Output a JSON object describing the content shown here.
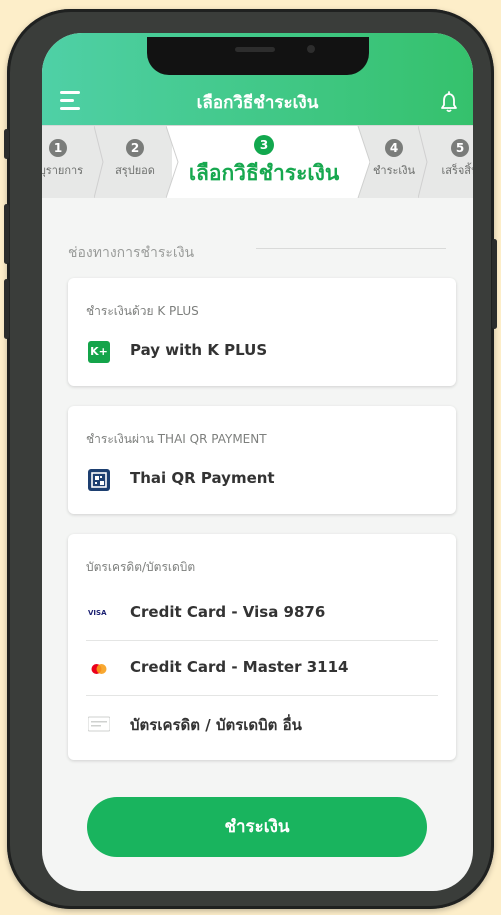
{
  "header": {
    "title": "เลือกวิธีชำระเงิน",
    "menu_icon": "hamburger-menu-icon",
    "bell_icon": "bell-icon",
    "gradient_start": "#4fd0a6",
    "gradient_end": "#35c16c"
  },
  "stepper": {
    "steps": [
      {
        "num": "1",
        "label": "ะบุรายการ"
      },
      {
        "num": "2",
        "label": "สรุปยอด"
      },
      {
        "num": "3",
        "label": "เลือกวิธีชำระเงิน",
        "active": true
      },
      {
        "num": "4",
        "label": "ชำระเงิน"
      },
      {
        "num": "5",
        "label": "เสร็จสิ้น"
      }
    ]
  },
  "section": {
    "label": "ช่องทางการชำระเงิน"
  },
  "cards": {
    "kplus": {
      "heading": "ชำระเงินด้วย K PLUS",
      "option": "Pay with K PLUS",
      "icon": "k-plus-icon",
      "icon_text": "K+"
    },
    "thaiqr": {
      "heading": "ชำระเงินผ่าน THAI QR PAYMENT",
      "option": "Thai QR Payment",
      "icon": "qr-payment-icon"
    },
    "cards": {
      "heading": "บัตรเครดิต/บัตรเดบิต",
      "visa": {
        "label": "Credit Card - Visa 9876",
        "icon": "visa-icon",
        "icon_text": "VISA"
      },
      "master": {
        "label": "Credit Card - Master 3114",
        "icon": "mastercard-icon"
      },
      "other": {
        "label": "บัตรเครดิต / บัตรเดบิต อื่น",
        "icon": "generic-card-icon"
      }
    }
  },
  "pay_button": {
    "label": "ชำระเงิน",
    "color": "#19b45e"
  },
  "colors": {
    "background": "#fdeec9",
    "accent_green": "#17a84f"
  }
}
